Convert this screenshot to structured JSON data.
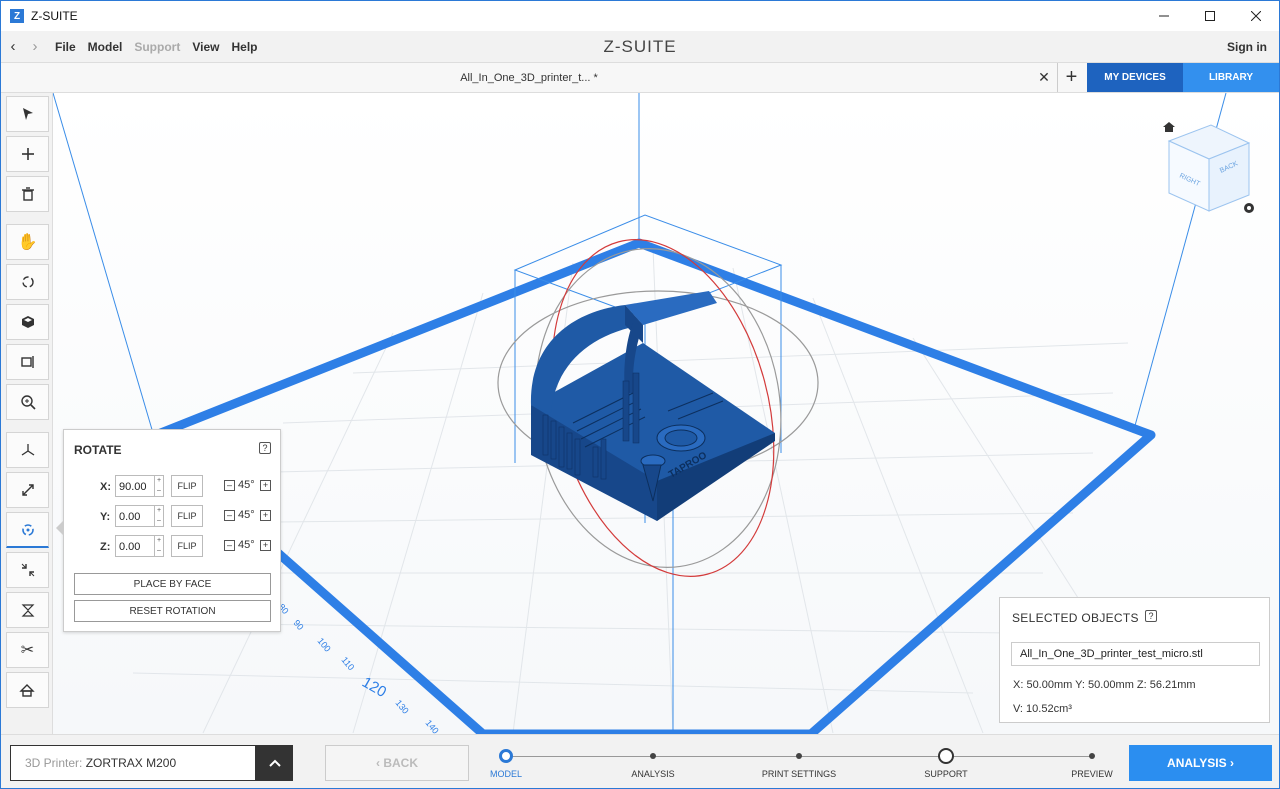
{
  "titlebar": {
    "app_icon_letter": "Z",
    "title": "Z-SUITE",
    "controls": [
      "minimize-icon",
      "maximize-icon",
      "close-icon"
    ]
  },
  "menubar": {
    "back_icon": "‹",
    "forward_icon": "›",
    "items": [
      "File",
      "Model",
      "Support",
      "View",
      "Help"
    ],
    "disabled_items": [
      "Support"
    ],
    "brand": "Z-SUITE",
    "sign_in": "Sign in"
  },
  "tabs": {
    "active_tab": "All_In_One_3D_printer_t... *",
    "my_devices": "MY DEVICES",
    "library": "LIBRARY"
  },
  "toolbar": {
    "tools": [
      "select-icon",
      "add-icon",
      "delete-icon",
      "pan-icon",
      "orbit-icon",
      "view-cube-icon",
      "fit-icon",
      "zoom-icon",
      "move-icon",
      "scale-icon",
      "rotate-icon",
      "autoscale-icon",
      "mirror-icon",
      "cut-icon",
      "home-view-icon"
    ],
    "active_tool": "rotate-icon"
  },
  "rotate": {
    "title": "ROTATE",
    "help": "?",
    "x_label": "X:",
    "x_value": "90.00",
    "y_label": "Y:",
    "y_value": "0.00",
    "z_label": "Z:",
    "z_value": "0.00",
    "flip": "FLIP",
    "step": "45°",
    "place_by_face": "PLACE BY FACE",
    "reset_rotation": "RESET ROTATION"
  },
  "viewport": {
    "ruler_labels": [
      "80",
      "90",
      "100",
      "110",
      "120",
      "130",
      "140"
    ],
    "ruler_major": "120",
    "colors": {
      "platform": "#2e7fe6",
      "model": "#1f5aa6",
      "ring_x": "#d33b3b",
      "ring_other": "#9a9a9a",
      "bbox": "#3a8de8"
    }
  },
  "selected": {
    "title": "SELECTED OBJECTS",
    "help": "?",
    "file": "All_In_One_3D_printer_test_micro.stl",
    "dims": "X: 50.00mm  Y: 50.00mm  Z: 56.21mm",
    "volume": "V: 10.52cm³"
  },
  "bottom": {
    "printer_label": "3D Printer: ",
    "printer_value": "ZORTRAX M200",
    "back": "‹  BACK",
    "steps": [
      "MODEL",
      "ANALYSIS",
      "PRINT SETTINGS",
      "SUPPORT",
      "PREVIEW"
    ],
    "active_step": "MODEL",
    "analysis_button": "ANALYSIS  ›"
  },
  "accent_color": "#2b79d6"
}
